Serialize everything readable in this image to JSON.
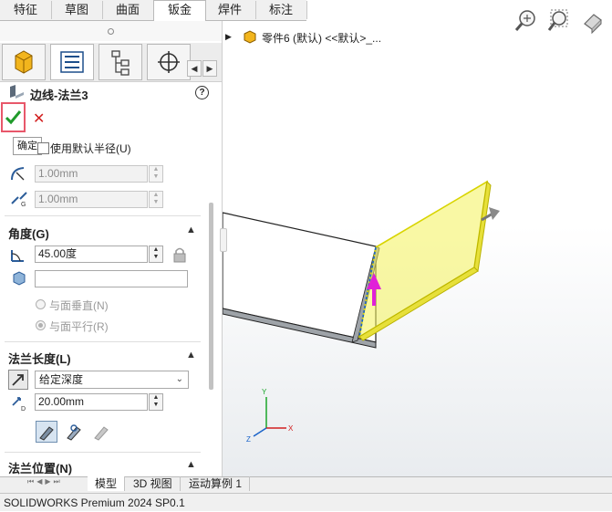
{
  "tabs": [
    "特征",
    "草图",
    "曲面",
    "钣金",
    "焊件",
    "标注"
  ],
  "active_tab": "钣金",
  "feature": {
    "title": "边线-法兰3"
  },
  "ok_tooltip": "确定",
  "radius": {
    "use_default_label": "使用默认半径(U)",
    "radius_value": "1.00mm",
    "gap_value": "1.00mm"
  },
  "angle": {
    "section_label": "角度(G)",
    "value": "45.00度",
    "perpendicular_label": "与面垂直(N)",
    "parallel_label": "与面平行(R)"
  },
  "length": {
    "section_label": "法兰长度(L)",
    "end_condition": "给定深度",
    "value": "20.00mm"
  },
  "position": {
    "section_label": "法兰位置(N)"
  },
  "tree": {
    "label": "零件6 (默认) <<默认>_..."
  },
  "axis": {
    "x": "X",
    "y": "Y",
    "z": "Z"
  },
  "bottom_tabs": [
    "模型",
    "3D 视图",
    "运动算例 1"
  ],
  "active_bottom_tab": "模型",
  "status_text": "SOLIDWORKS Premium 2024 SP0.1",
  "colors": {
    "ok": "#1f9a2a",
    "cancel": "#d21f1f",
    "highlight": "#f4f35a",
    "accent": "#e8576a",
    "arrow": "#e020d8"
  }
}
